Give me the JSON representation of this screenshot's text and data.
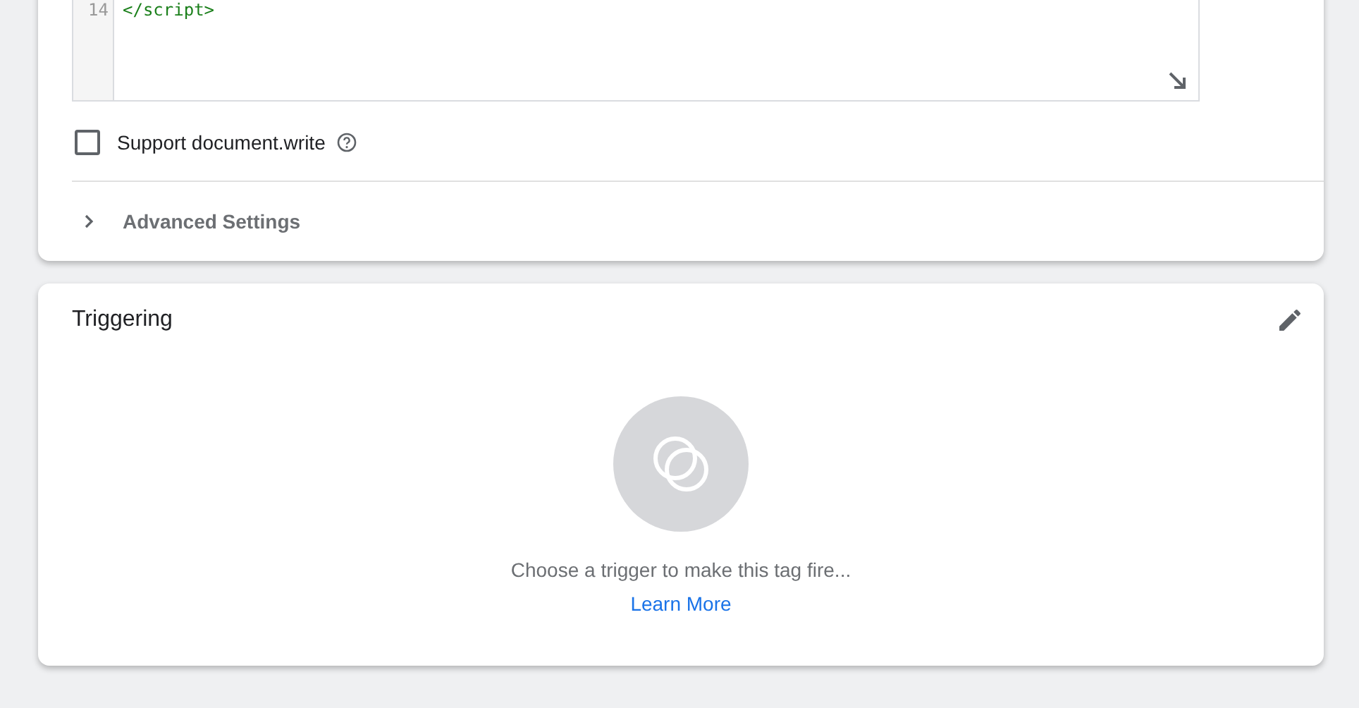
{
  "code_editor": {
    "lines": [
      {
        "number": "14",
        "code": "</script>"
      }
    ]
  },
  "support_document_write": {
    "label": "Support document.write",
    "checked": false
  },
  "advanced_settings": {
    "label": "Advanced Settings",
    "expanded": false
  },
  "triggering": {
    "title": "Triggering",
    "empty_message": "Choose a trigger to make this tag fire...",
    "link": "Learn More"
  }
}
